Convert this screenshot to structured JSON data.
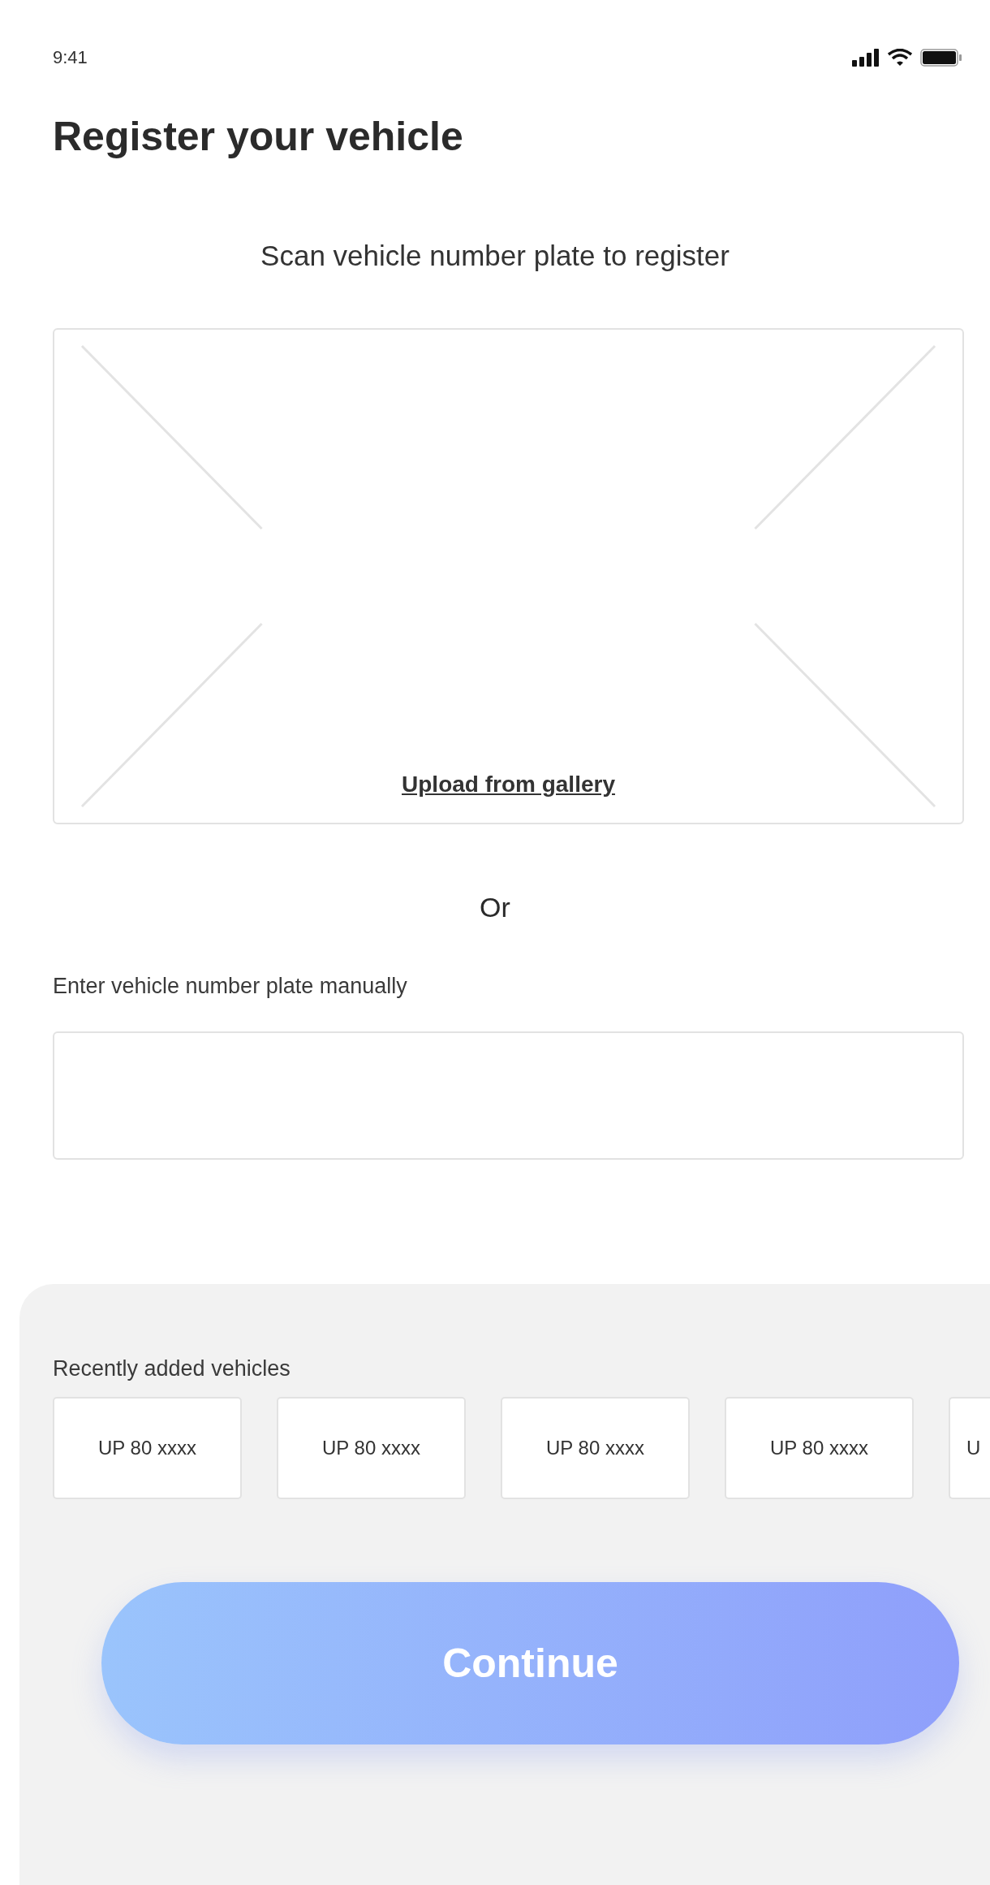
{
  "status_bar": {
    "time": "9:41"
  },
  "title": "Register your vehicle",
  "scan": {
    "prompt": "Scan vehicle number plate to register",
    "upload_link": "Upload from gallery"
  },
  "divider_text": "Or",
  "manual_entry": {
    "label": "Enter vehicle number plate manually"
  },
  "recent": {
    "heading": "Recently added vehicles",
    "vehicles": [
      {
        "plate": "UP 80 xxxx",
        "kind": "full"
      },
      {
        "plate": "UP 80 xxxx",
        "kind": "full"
      },
      {
        "plate": "UP 80 xxxx",
        "kind": "full"
      },
      {
        "plate": "UP 80 xxxx",
        "kind": "full"
      },
      {
        "plate": "U",
        "kind": "partial"
      }
    ]
  },
  "continue_button": "Continue"
}
